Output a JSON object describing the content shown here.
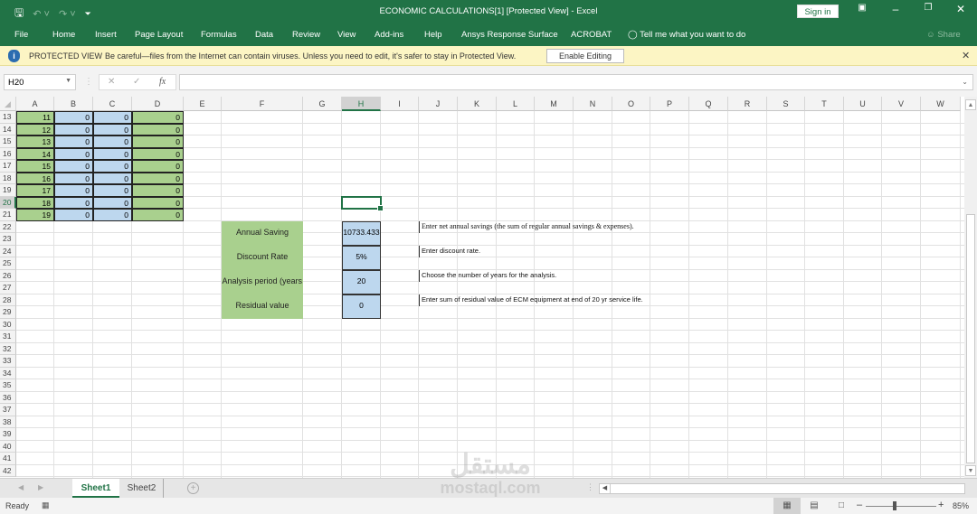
{
  "window": {
    "title": "ECONOMIC CALCULATIONS[1]  [Protected View]  -  Excel",
    "signin_label": "Sign in",
    "qat": {
      "save_icon": "save-icon",
      "undo_icon": "undo-icon",
      "redo_icon": "redo-icon",
      "customize_icon": "customize-qat-icon"
    }
  },
  "ribbon": {
    "tabs": [
      "File",
      "Home",
      "Insert",
      "Page Layout",
      "Formulas",
      "Data",
      "Review",
      "View",
      "Add-ins",
      "Help",
      "Ansys Response Surface",
      "ACROBAT"
    ],
    "tell_me": "Tell me what you want to do",
    "share_label": "Share"
  },
  "protected_view": {
    "label": "PROTECTED VIEW",
    "message": "Be careful—files from the Internet can contain viruses. Unless you need to edit, it's safer to stay in Protected View.",
    "button_label": "Enable Editing"
  },
  "formula_bar": {
    "name_box": "H20",
    "formula": ""
  },
  "grid": {
    "columns": [
      "A",
      "B",
      "C",
      "D",
      "E",
      "F",
      "G",
      "H",
      "I",
      "J",
      "K",
      "L",
      "M",
      "N",
      "O",
      "P",
      "Q",
      "R",
      "S",
      "T",
      "U",
      "V",
      "W"
    ],
    "selected_column": "H",
    "rows": [
      13,
      14,
      15,
      16,
      17,
      18,
      19,
      20,
      21,
      22,
      23,
      24,
      25,
      26,
      27,
      28,
      29,
      30,
      31,
      32,
      33,
      34,
      35,
      36,
      37,
      38,
      39,
      40,
      41,
      42
    ],
    "selected_row": 20,
    "table_rows": [
      {
        "row": 13,
        "A": "11",
        "B": "0",
        "C": "0",
        "D": "0"
      },
      {
        "row": 14,
        "A": "12",
        "B": "0",
        "C": "0",
        "D": "0"
      },
      {
        "row": 15,
        "A": "13",
        "B": "0",
        "C": "0",
        "D": "0"
      },
      {
        "row": 16,
        "A": "14",
        "B": "0",
        "C": "0",
        "D": "0"
      },
      {
        "row": 17,
        "A": "15",
        "B": "0",
        "C": "0",
        "D": "0"
      },
      {
        "row": 18,
        "A": "16",
        "B": "0",
        "C": "0",
        "D": "0"
      },
      {
        "row": 19,
        "A": "17",
        "B": "0",
        "C": "0",
        "D": "0"
      },
      {
        "row": 20,
        "A": "18",
        "B": "0",
        "C": "0",
        "D": "0"
      },
      {
        "row": 21,
        "A": "19",
        "B": "0",
        "C": "0",
        "D": "0"
      }
    ],
    "inputs": [
      {
        "label": "Annual Saving",
        "value": "10733.433",
        "note": "Enter net annual savings (the sum of regular annual savings & expenses)."
      },
      {
        "label": "Discount Rate",
        "value": "5%",
        "note": "Enter discount rate."
      },
      {
        "label": "Analysis period (years",
        "value": "20",
        "note": "Choose the number of years for the analysis."
      },
      {
        "label": "Residual value",
        "value": "0",
        "note": "Enter sum of residual value of ECM equipment at end of 20 yr service life."
      }
    ]
  },
  "sheets": {
    "tabs": [
      "Sheet1",
      "Sheet2"
    ],
    "active": "Sheet1"
  },
  "status": {
    "ready": "Ready",
    "zoom": "85%",
    "zoom_level_percent": 85
  },
  "colors": {
    "excel_green": "#217346",
    "cell_green": "#a9d08e",
    "cell_blue": "#bdd7ee",
    "protected_bar": "#fcf5c4"
  },
  "watermark": {
    "arabic": "مستقل",
    "latin": "mostaql.com"
  }
}
